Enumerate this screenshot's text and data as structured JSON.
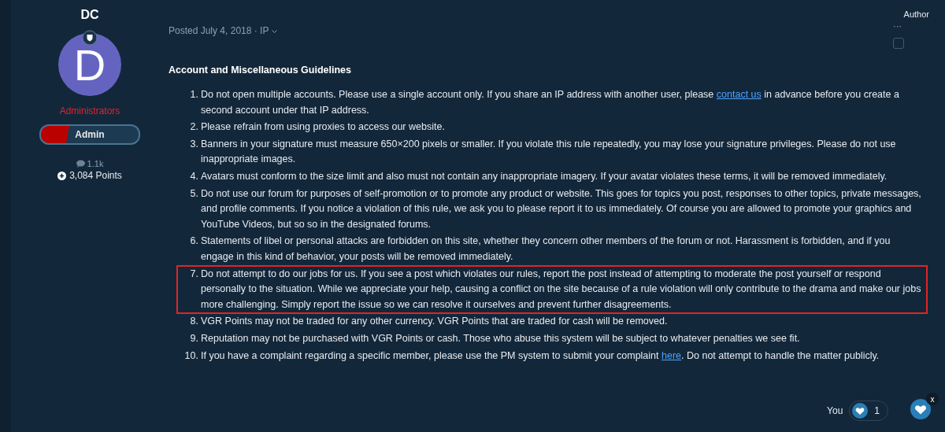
{
  "author": {
    "name": "DC",
    "avatar_letter": "D",
    "group": "Administrators",
    "rank": "Admin",
    "posts": "1.1k",
    "points": "3,084 Points"
  },
  "post": {
    "meta": "Posted July 4, 2018 · IP",
    "badge": "Author",
    "menu": "···",
    "checked": false,
    "heading": "Account and Miscellaneous Guidelines",
    "rules": [
      {
        "number": "1.",
        "before": "Do not open multiple accounts.  Please use a single account only.  If you share an IP address with another user, please ",
        "link": "contact us",
        "after": " in advance before you create a second account under that IP address.",
        "highlighted": false
      },
      {
        "number": "2.",
        "before": "Please refrain from using proxies to access our website.",
        "highlighted": false
      },
      {
        "number": "3.",
        "before": "Banners in your signature must measure 650×200 pixels or smaller.  If you violate this rule repeatedly, you may lose your signature privileges.  Please do not use inappropriate images.",
        "highlighted": false
      },
      {
        "number": "4.",
        "before": "Avatars must conform to the size limit and also must not contain any inappropriate imagery.  If your avatar violates these terms, it will be removed immediately.",
        "highlighted": false
      },
      {
        "number": "5.",
        "before": "Do not use our forum for purposes of self-promotion or to promote any product or website.  This goes for topics you post, responses to other topics, private messages, and profile comments.  If you notice a violation of this rule, we ask you to please report it to us immediately.  Of course you are allowed to promote your graphics and YouTube Videos, but so so in the designated forums.",
        "highlighted": false
      },
      {
        "number": "6.",
        "before": "Statements of libel or personal attacks are forbidden on this site, whether they concern other members of the forum or not.  Harassment is forbidden, and if you engage in this kind of behavior, your posts will be removed immediately.",
        "highlighted": false
      },
      {
        "number": "7.",
        "before": "Do not attempt to do our jobs for us.  If you see a post which violates our rules, report the post instead of attempting to moderate the post yourself or respond personally to the situation.  While we appreciate your help, causing a conflict on the site because of a rule violation will only contribute to the drama and make our jobs more challenging.  Simply report the issue so we can resolve it ourselves and prevent further disagreements.",
        "highlighted": true
      },
      {
        "number": "8.",
        "before": "VGR Points may not be traded for any other currency.  VGR Points that are traded for cash will be removed.",
        "highlighted": false
      },
      {
        "number": "9.",
        "before": "Reputation may not be purchased with VGR Points or cash.  Those who abuse this system will be subject to whatever penalties we see fit.",
        "highlighted": false
      },
      {
        "number": "10.",
        "before": "If you have a complaint regarding a specific member, please use the PM system to submit your complaint ",
        "link": "here",
        "after": ".  Do not attempt to handle the matter publicly.",
        "highlighted": false
      }
    ],
    "reactions": {
      "label": "You",
      "count": "1",
      "close": "x"
    }
  }
}
